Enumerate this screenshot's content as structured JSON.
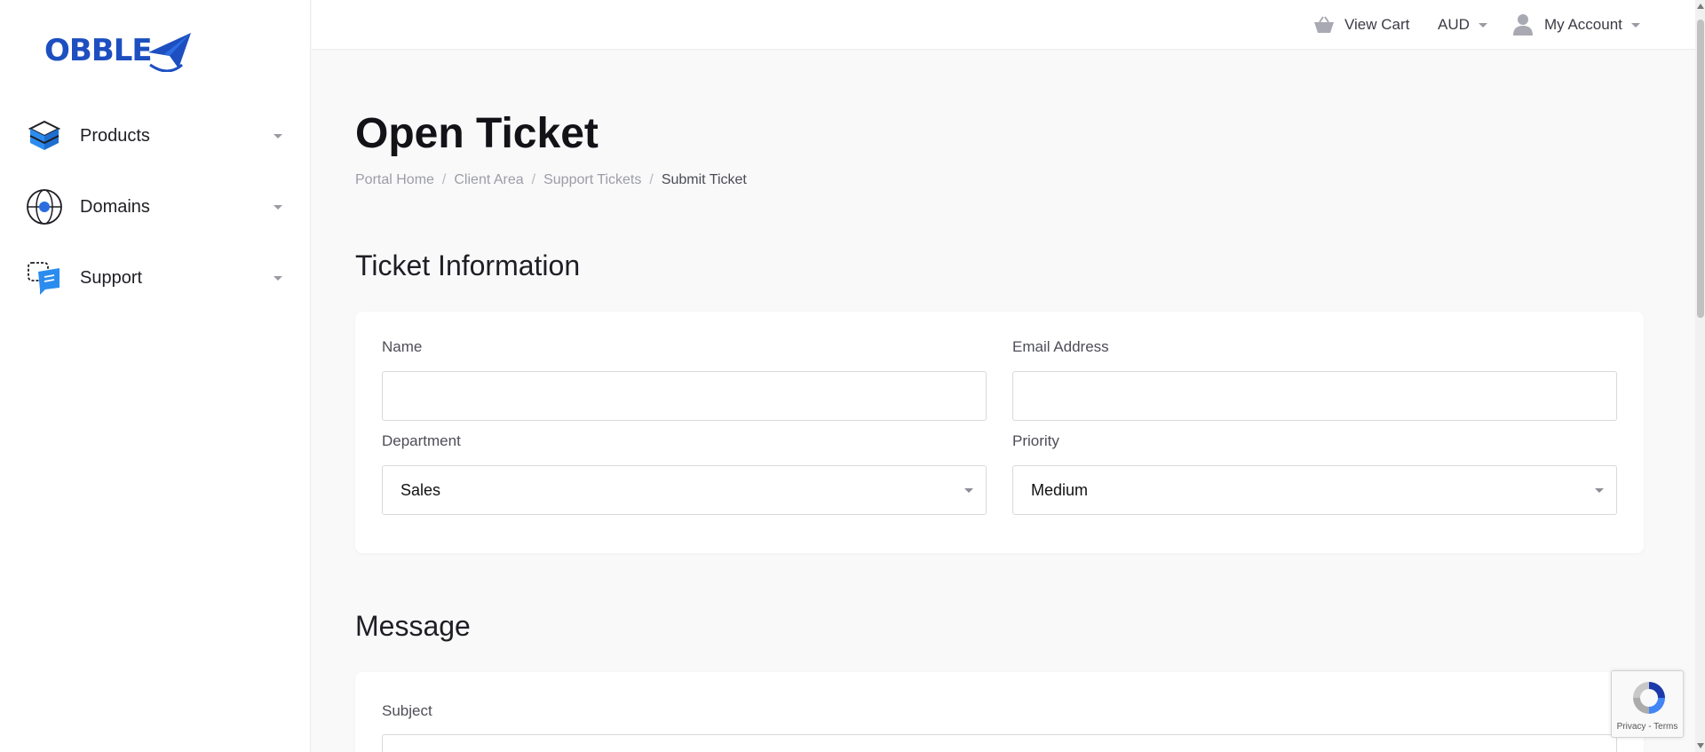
{
  "brand": {
    "logo_text": "OBBLE"
  },
  "sidebar": {
    "items": [
      {
        "label": "Products",
        "icon": "box-icon"
      },
      {
        "label": "Domains",
        "icon": "globe-icon"
      },
      {
        "label": "Support",
        "icon": "chat-bubbles-icon"
      }
    ]
  },
  "topbar": {
    "cart_label": "View Cart",
    "currency_label": "AUD",
    "account_label": "My Account"
  },
  "page": {
    "title": "Open Ticket",
    "breadcrumb": [
      "Portal Home",
      "Client Area",
      "Support Tickets",
      "Submit Ticket"
    ],
    "breadcrumb_separator": "/"
  },
  "ticket_info": {
    "section_title": "Ticket Information",
    "name_label": "Name",
    "name_value": "",
    "email_label": "Email Address",
    "email_value": "",
    "department_label": "Department",
    "department_value": "Sales",
    "priority_label": "Priority",
    "priority_value": "Medium"
  },
  "message": {
    "section_title": "Message",
    "subject_label": "Subject",
    "subject_value": ""
  },
  "recaptcha": {
    "links": "Privacy - Terms"
  },
  "colors": {
    "brand": "#1d4fc0",
    "accent_blue": "#2b8cf0",
    "background": "#f9f9fa",
    "card": "#ffffff"
  }
}
